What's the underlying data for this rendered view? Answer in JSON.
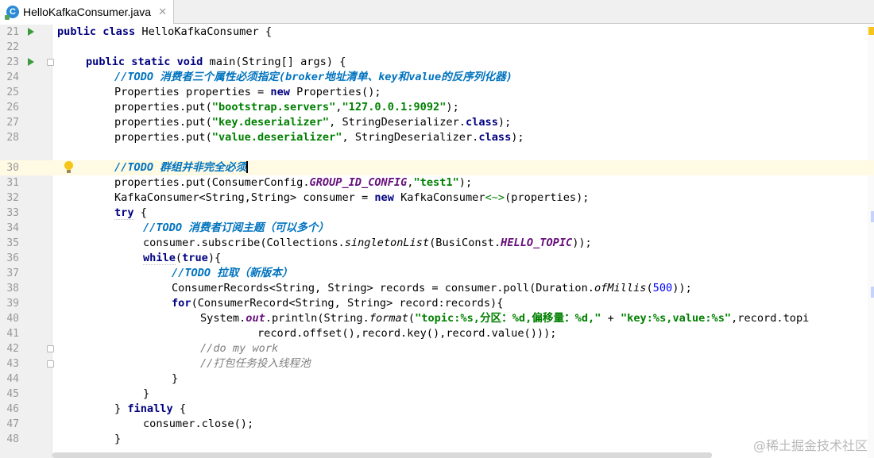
{
  "tab": {
    "icon_letter": "C",
    "title": "HelloKafkaConsumer.java",
    "close_glyph": "✕"
  },
  "editor": {
    "current_line": 30,
    "line_numbers": [
      "21",
      "22",
      "23",
      "24",
      "25",
      "26",
      "27",
      "28",
      "30",
      "31",
      "32",
      "33",
      "34",
      "35",
      "36",
      "37",
      "38",
      "39",
      "40",
      "41",
      "42",
      "43",
      "44",
      "45",
      "46",
      "47",
      "48"
    ],
    "code": {
      "l21": {
        "kw1": "public",
        "kw2": "class",
        "rest": " HelloKafkaConsumer {"
      },
      "l23": {
        "kw1": "public",
        "kw2": "static",
        "kw3": "void",
        "rest": " main(String[] args) {"
      },
      "l24": {
        "prefix": "//",
        "todo": "TODO 消费者三个属性必须指定(broker地址清单、key和value的反序列化器)"
      },
      "l25": {
        "a": "Properties properties = ",
        "kw": "new",
        "b": " Properties();"
      },
      "l26": {
        "a": "properties.put(",
        "s1": "\"bootstrap.servers\"",
        "b": ",",
        "s2": "\"127.0.0.1:9092\"",
        "c": ");"
      },
      "l27": {
        "a": "properties.put(",
        "s1": "\"key.deserializer\"",
        "b": ", StringDeserializer.",
        "kw": "class",
        "c": ");"
      },
      "l28": {
        "a": "properties.put(",
        "s1": "\"value.deserializer\"",
        "b": ", StringDeserializer.",
        "kw": "class",
        "c": ");"
      },
      "l30": {
        "prefix": "//",
        "todo": "TODO 群组并非完全必须"
      },
      "l31": {
        "a": "properties.put(ConsumerConfig.",
        "f": "GROUP_ID_CONFIG",
        "b": ",",
        "s1": "\"test1\"",
        "c": ");"
      },
      "l32": {
        "a": "KafkaConsumer<String,String> consumer = ",
        "kw": "new",
        "b": " KafkaConsumer",
        "d": "<~>",
        "c": "(properties);"
      },
      "l33": {
        "kw": "try",
        "rest": " {"
      },
      "l34": {
        "prefix": "//",
        "todo": "TODO 消费者订阅主题（可以多个）"
      },
      "l35": {
        "a": "consumer.subscribe(Collections.",
        "i": "singletonList",
        "b": "(BusiConst.",
        "f": "HELLO_TOPIC",
        "c": "));"
      },
      "l36": {
        "kw1": "while",
        "a": "(",
        "kw2": "true",
        "b": "){"
      },
      "l37": {
        "prefix": "//",
        "todo": "TODO 拉取（新版本）"
      },
      "l38": {
        "a": "ConsumerRecords<String, String> records = consumer.poll(Duration.",
        "i": "ofMillis",
        "b": "(",
        "n": "500",
        "c": "));"
      },
      "l39": {
        "kw": "for",
        "rest": "(ConsumerRecord<String, String> record:records){"
      },
      "l40": {
        "a": "System.",
        "f": "out",
        "b": ".println(String.",
        "i": "format",
        "c": "(",
        "s1": "\"topic:%s,分区：%d,偏移量：%d,\"",
        "d": " + ",
        "s2": "\"key:%s,value:%s\"",
        "e": ",record.topi"
      },
      "l41": {
        "rest": "record.offset(),record.key(),record.value()));"
      },
      "l42": {
        "cmt": "//do my work"
      },
      "l43": {
        "cmt": "//打包任务投入线程池"
      },
      "l44": {
        "rest": "}"
      },
      "l45": {
        "rest": "}"
      },
      "l46": {
        "a": "} ",
        "kw": "finally",
        "b": " {"
      },
      "l47": {
        "rest": "consumer.close();"
      },
      "l48": {
        "rest": "}"
      }
    }
  },
  "watermark": "@稀土掘金技术社区",
  "colors": {
    "keyword": "#000080",
    "string": "#008000",
    "todo": "#0073bf",
    "comment": "#808080",
    "field": "#660e7a",
    "current_line": "#fffae3"
  }
}
